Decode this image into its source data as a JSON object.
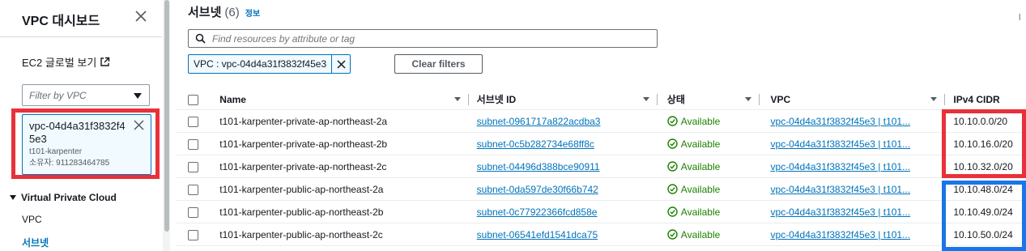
{
  "sidebar": {
    "title": "VPC 대시보드",
    "ec2_link": "EC2 글로벌 보기",
    "vpc_filter_placeholder": "Filter by VPC",
    "selected_vpc": {
      "id": "vpc-04d4a31f3832f45e3",
      "name": "t101-karpenter",
      "owner": "소유자: 911283464785"
    },
    "section_title": "Virtual Private Cloud",
    "items": [
      {
        "label": "VPC"
      },
      {
        "label": "서브넷"
      }
    ]
  },
  "main": {
    "title": "서브넷",
    "count": "(6)",
    "info_label": "정보",
    "search_placeholder": "Find resources by attribute or tag",
    "filter_token": "VPC : vpc-04d4a31f3832f45e3",
    "clear_filters_label": "Clear filters",
    "right_mark": "l"
  },
  "table": {
    "columns": [
      "Name",
      "서브넷 ID",
      "상태",
      "VPC",
      "IPv4 CIDR"
    ],
    "rows": [
      {
        "name": "t101-karpenter-private-ap-northeast-2a",
        "subnet_id": "subnet-0961717a822acdba3",
        "status": "Available",
        "vpc": "vpc-04d4a31f3832f45e3 | t101...",
        "cidr": "10.10.0.0/20"
      },
      {
        "name": "t101-karpenter-private-ap-northeast-2b",
        "subnet_id": "subnet-0c5b282734e68ff8c",
        "status": "Available",
        "vpc": "vpc-04d4a31f3832f45e3 | t101...",
        "cidr": "10.10.16.0/20"
      },
      {
        "name": "t101-karpenter-private-ap-northeast-2c",
        "subnet_id": "subnet-04496d388bce90911",
        "status": "Available",
        "vpc": "vpc-04d4a31f3832f45e3 | t101...",
        "cidr": "10.10.32.0/20"
      },
      {
        "name": "t101-karpenter-public-ap-northeast-2a",
        "subnet_id": "subnet-0da597de30f66b742",
        "status": "Available",
        "vpc": "vpc-04d4a31f3832f45e3 | t101...",
        "cidr": "10.10.48.0/24"
      },
      {
        "name": "t101-karpenter-public-ap-northeast-2b",
        "subnet_id": "subnet-0c77922366fcd858e",
        "status": "Available",
        "vpc": "vpc-04d4a31f3832f45e3 | t101...",
        "cidr": "10.10.49.0/24"
      },
      {
        "name": "t101-karpenter-public-ap-northeast-2c",
        "subnet_id": "subnet-06541efd1541dca75",
        "status": "Available",
        "vpc": "vpc-04d4a31f3832f45e3 | t101...",
        "cidr": "10.10.50.0/24"
      }
    ]
  },
  "colors": {
    "link": "#0073bb",
    "available": "#1d8102",
    "highlight_red": "#e8313a",
    "highlight_blue": "#1975e8"
  },
  "icons": [
    "close-icon",
    "external-link-icon",
    "search-icon",
    "dismiss-icon",
    "check-circle-icon",
    "caret-down-icon"
  ]
}
